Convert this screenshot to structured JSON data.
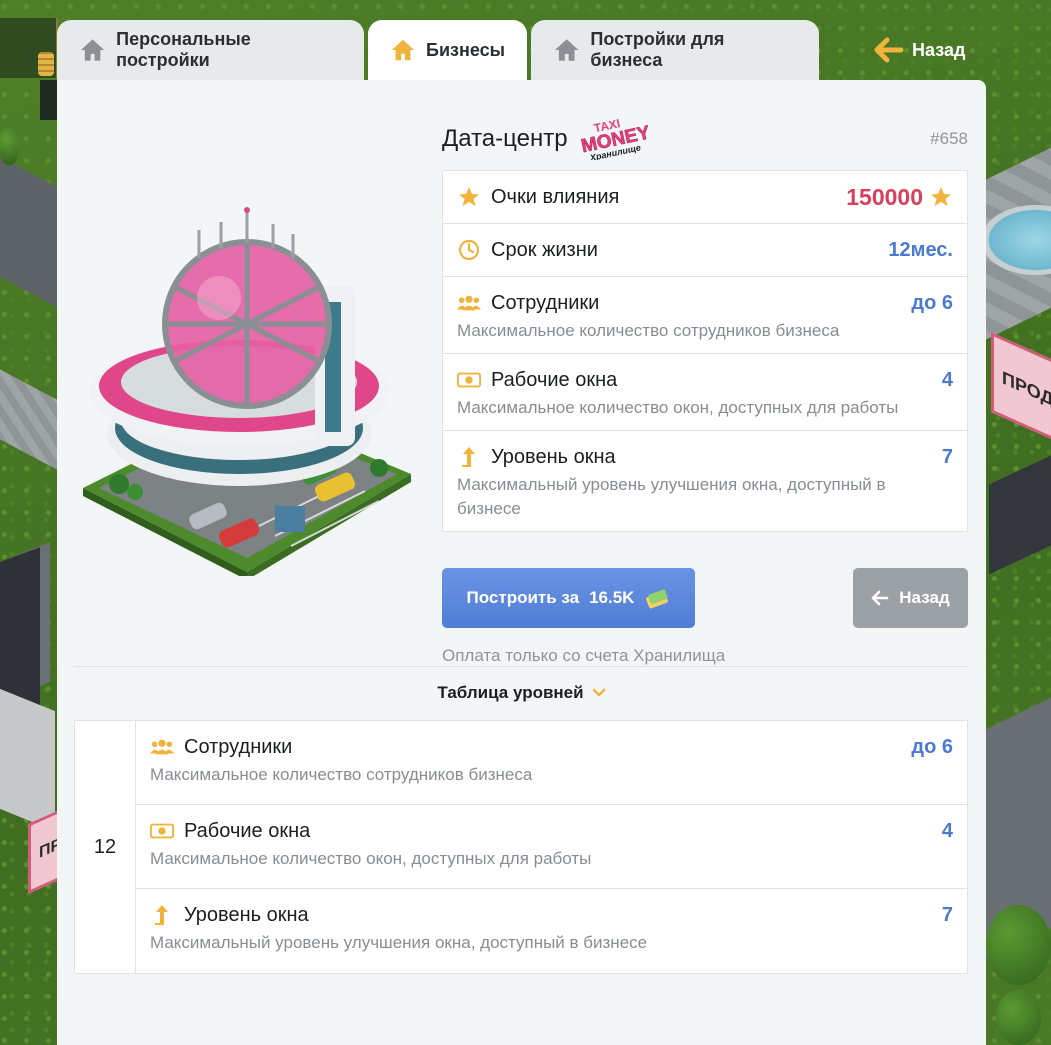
{
  "tabs": [
    {
      "label": "Персональные постройки"
    },
    {
      "label": "Бизнесы"
    },
    {
      "label": "Постройки для бизнеса"
    }
  ],
  "back_top": {
    "label": "Назад"
  },
  "business": {
    "title": "Дата-центр",
    "logo_text": {
      "line1": "TAXI",
      "line2": "MONEY",
      "line3": "Хранилище"
    },
    "id": "#658"
  },
  "stats": {
    "influence": {
      "label": "Очки влияния",
      "value": "150000"
    },
    "lifetime": {
      "label": "Срок жизни",
      "value": "12мес."
    },
    "employees": {
      "label": "Сотрудники",
      "value": "до 6",
      "desc": "Максимальное количество сотрудников бизнеса"
    },
    "windows": {
      "label": "Рабочие окна",
      "value": "4",
      "desc": "Максимальное количество окон, доступных для работы"
    },
    "window_level": {
      "label": "Уровень окна",
      "value": "7",
      "desc": "Максимальный уровень улучшения окна, доступный в бизнесе"
    }
  },
  "build_button": {
    "label": "Построить за",
    "price": "16.5K"
  },
  "back_button": {
    "label": "Назад"
  },
  "payment_note": "Оплата только со счета Хранилища",
  "levels_toggle": {
    "label": "Таблица уровней"
  },
  "level_table": {
    "level": "12",
    "rows": [
      {
        "label": "Сотрудники",
        "value": "до 6",
        "desc": "Максимальное количество сотрудников бизнеса"
      },
      {
        "label": "Рабочие окна",
        "value": "4",
        "desc": "Максимальное количество окон, доступных для работы"
      },
      {
        "label": "Уровень окна",
        "value": "7",
        "desc": "Максимальный уровень улучшения окна, доступный в бизнесе"
      }
    ]
  },
  "background_signs": [
    "ПРОДАН",
    "ПРО"
  ],
  "colors": {
    "accent_blue": "#4a7bd1",
    "influence_red": "#d8405b",
    "icon_gold": "#f0b43a",
    "back_button_gray": "#9ca1a6",
    "panel_bg": "#f3f6f7"
  },
  "icons": {
    "tab": "house-icon",
    "back": "arrow-left-icon",
    "influence": "star-icon",
    "lifetime": "clock-icon",
    "employees": "people-icon",
    "windows": "cash-window-icon",
    "window_level": "arrow-up-icon",
    "build": "money-stack-icon",
    "toggle": "chevron-down-icon"
  }
}
